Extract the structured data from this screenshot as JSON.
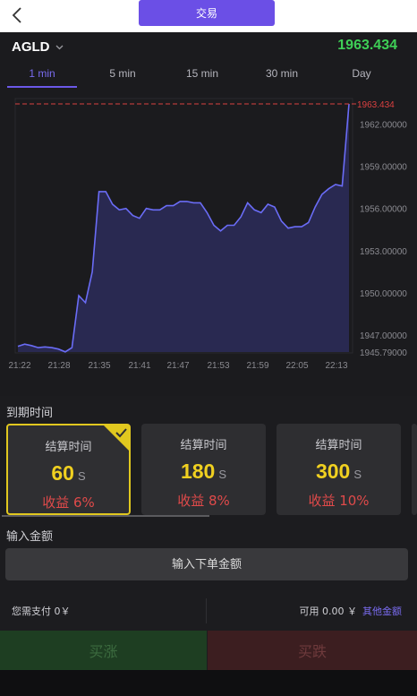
{
  "header": {
    "title": "交易"
  },
  "symbol": {
    "name": "AGLD",
    "price": "1963.434"
  },
  "tabs": [
    {
      "label": "1 min",
      "active": true
    },
    {
      "label": "5 min",
      "active": false
    },
    {
      "label": "15 min",
      "active": false
    },
    {
      "label": "30 min",
      "active": false
    },
    {
      "label": "Day",
      "active": false
    }
  ],
  "chart_data": {
    "type": "area",
    "x_ticks": [
      "21:22",
      "21:28",
      "21:35",
      "21:41",
      "21:47",
      "21:53",
      "21:59",
      "22:05",
      "22:13"
    ],
    "y_ticks": [
      "1962.00000",
      "1959.00000",
      "1956.00000",
      "1953.00000",
      "1950.00000",
      "1947.00000",
      "1945.79000"
    ],
    "current_label": "1963.434",
    "ylim": [
      1945.79,
      1963.434
    ],
    "series": [
      {
        "values": [
          1946.2,
          1946.35,
          1946.25,
          1946.1,
          1946.15,
          1946.1,
          1946.0,
          1945.8,
          1946.1,
          1949.8,
          1949.3,
          1951.5,
          1957.2,
          1957.2,
          1956.3,
          1955.9,
          1956.0,
          1955.5,
          1955.3,
          1956.0,
          1955.9,
          1955.9,
          1956.2,
          1956.2,
          1956.5,
          1956.5,
          1956.4,
          1956.4,
          1955.7,
          1954.8,
          1954.4,
          1954.8,
          1954.8,
          1955.4,
          1956.4,
          1955.9,
          1955.7,
          1956.3,
          1956.1,
          1955.1,
          1954.6,
          1954.7,
          1954.7,
          1955.0,
          1956.1,
          1957.0,
          1957.4,
          1957.7,
          1957.6,
          1963.434
        ]
      }
    ],
    "line_color": "#6a6cf6",
    "fill_color": "#2c2b5a",
    "marker_line_color": "#d94040"
  },
  "expiry": {
    "label": "到期时间",
    "cards": [
      {
        "title": "结算时间",
        "value": "60",
        "unit": "S",
        "profit": "收益 6%",
        "selected": true
      },
      {
        "title": "结算时间",
        "value": "180",
        "unit": "S",
        "profit": "收益 8%",
        "selected": false
      },
      {
        "title": "结算时间",
        "value": "300",
        "unit": "S",
        "profit": "收益 10%",
        "selected": false
      }
    ]
  },
  "amount": {
    "label": "输入金额",
    "placeholder": "输入下单金额"
  },
  "info": {
    "pay": "您需支付 0￥",
    "available": "可用 0.00 ￥",
    "other_amount": "其他金额"
  },
  "actions": {
    "buy_up": "买涨",
    "buy_down": "买跌"
  },
  "colors": {
    "accent": "#6b4fe6",
    "up": "#3ecf56",
    "down": "#e04a4a",
    "highlight": "#f0d020"
  }
}
